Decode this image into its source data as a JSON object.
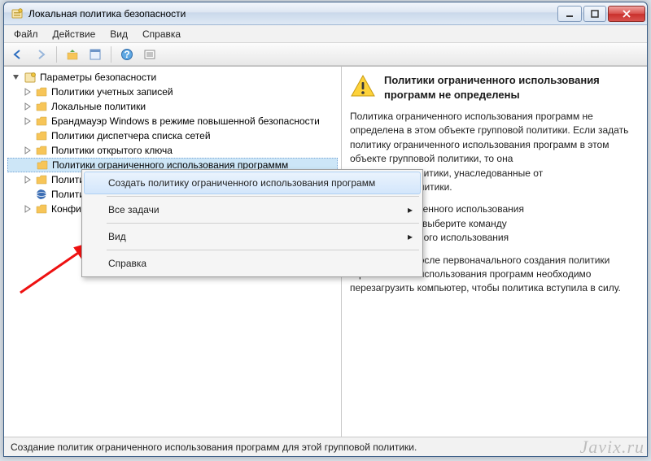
{
  "window": {
    "title": "Локальная политика безопасности"
  },
  "menubar": {
    "file": "Файл",
    "action": "Действие",
    "view": "Вид",
    "help": "Справка"
  },
  "tree": {
    "root": "Параметры безопасности",
    "items": [
      "Политики учетных записей",
      "Локальные политики",
      "Брандмауэр Windows в режиме повышенной безопасности",
      "Политики диспетчера списка сетей",
      "Политики открытого ключа",
      "Политики ограниченного использования программм",
      "Полити",
      "Полити",
      "Конфи"
    ]
  },
  "context_menu": {
    "create": "Создать политику ограниченного использования программ",
    "all_tasks": "Все задачи",
    "view": "Вид",
    "help": "Справка"
  },
  "info": {
    "title": "Политики ограниченного использования программ не определены",
    "p1": "Политика ограниченного использования программ не определена в этом объекте групповой политики. Если задать политику ограниченного использования программ в этом объекте групповой политики, то она",
    "p1b": "араметры политики, унаследованные от",
    "p1c": "групповой политики.",
    "p2a": "итику ограниченного использования",
    "p2b": "ю \"Действие\" выберите команду",
    "p2c": "ку ограниченного использования",
    "p3": "Примечание. После первоначального создания политики ограниченного использования программ необходимо перезагрузить компьютер, чтобы политика вступила в силу."
  },
  "statusbar": {
    "text": "Создание политик ограниченного использования программ для этой групповой политики."
  },
  "watermark": "Javix.ru"
}
